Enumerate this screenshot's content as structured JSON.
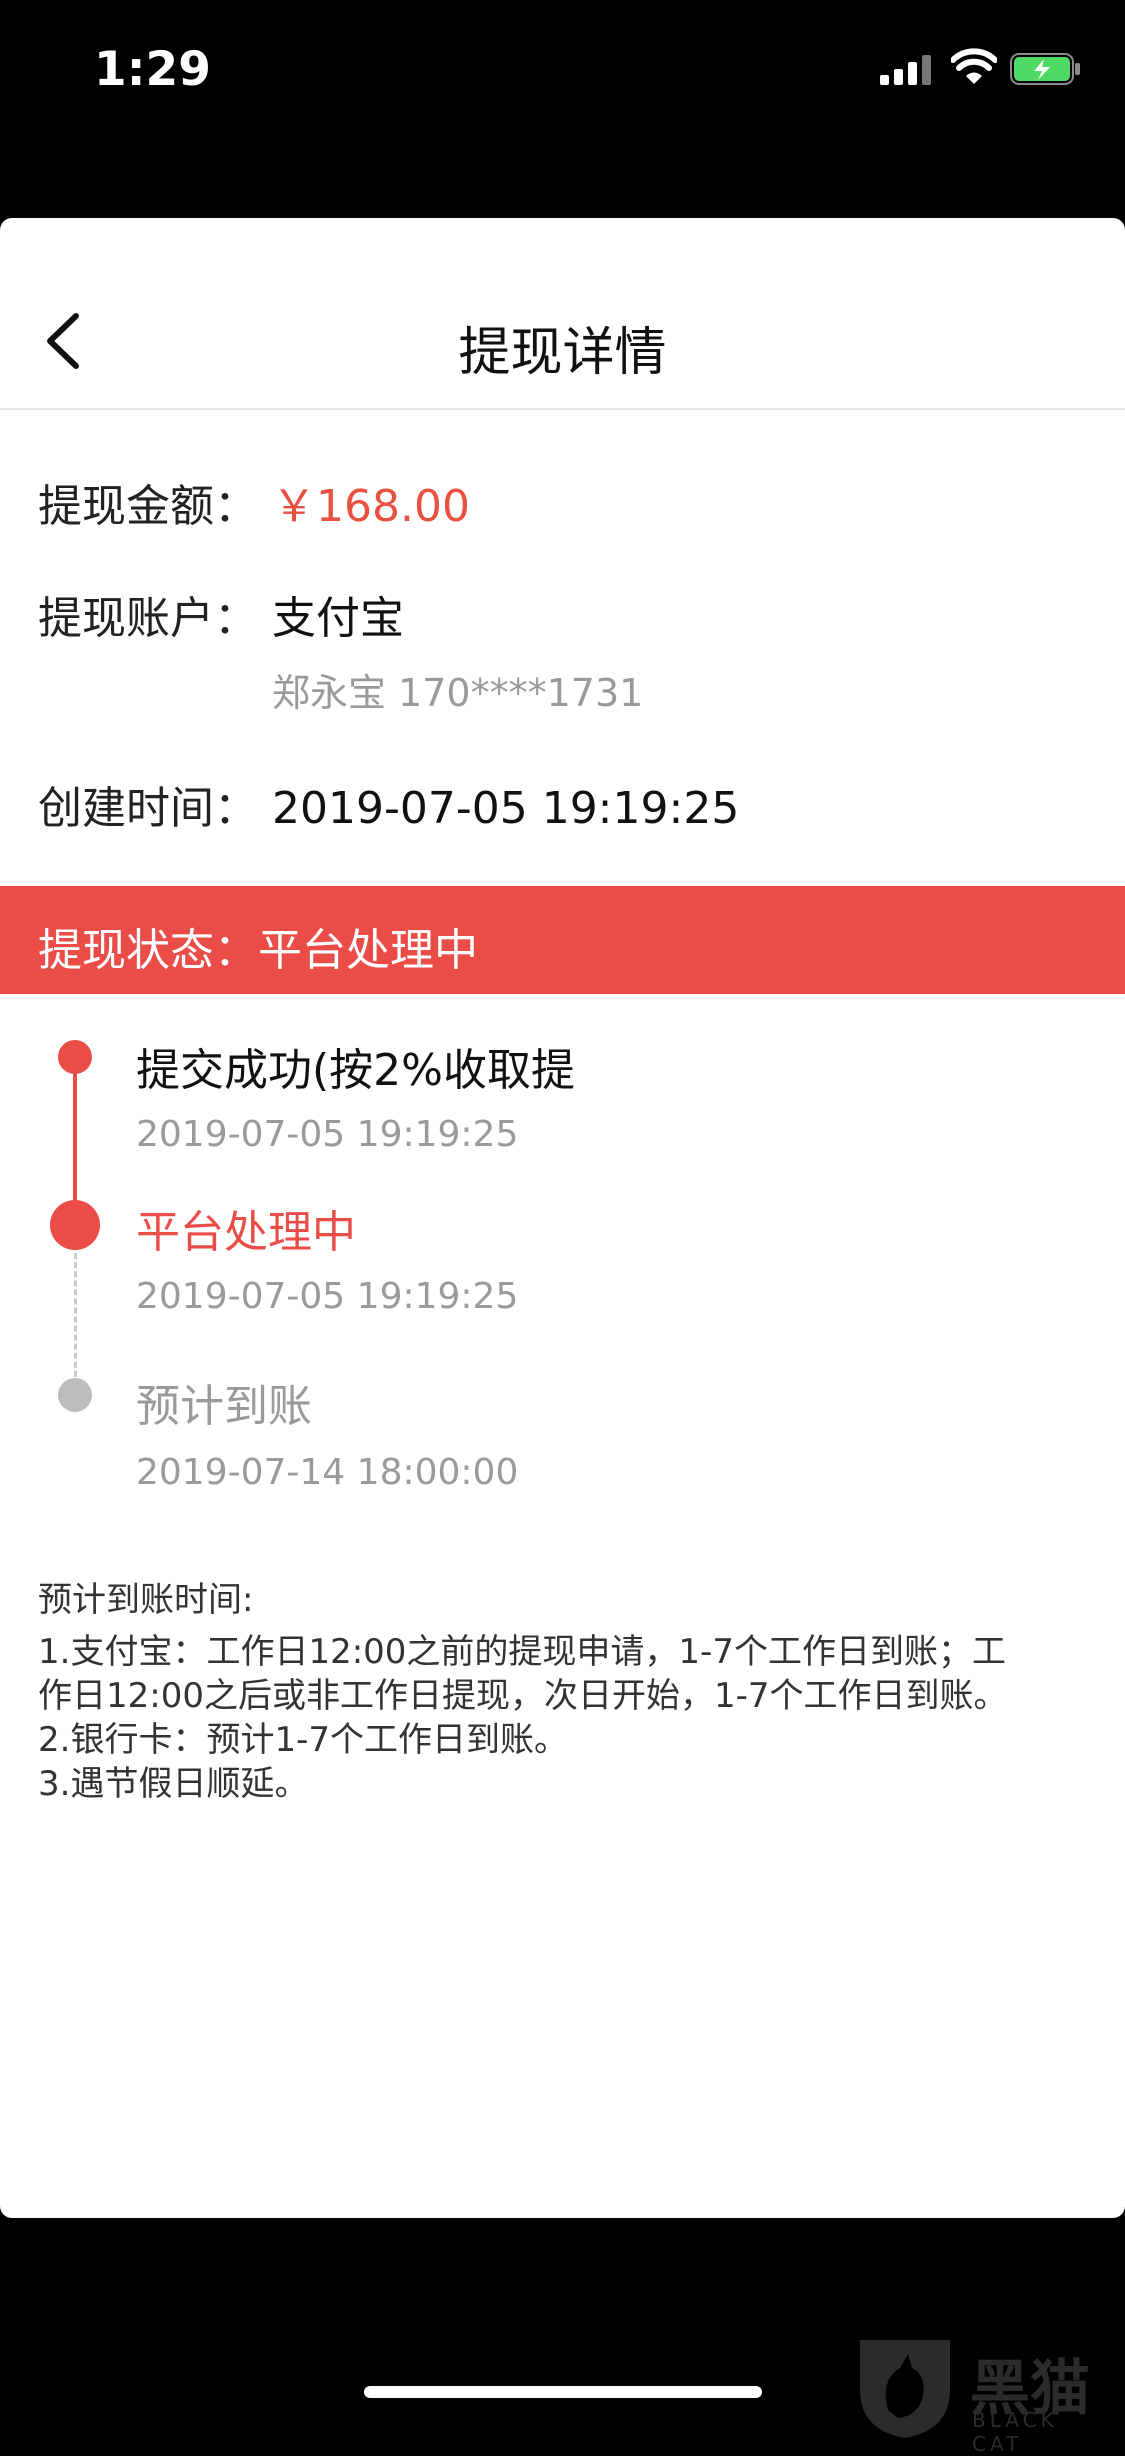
{
  "status_bar": {
    "time": "1:29"
  },
  "nav": {
    "title": "提现详情"
  },
  "details": {
    "amount_label": "提现金额：",
    "amount_value": "￥168.00",
    "account_label": "提现账户：",
    "account_value": "支付宝",
    "account_holder": "郑永宝 170****1731",
    "created_label": "创建时间：",
    "created_value": "2019-07-05 19:19:25"
  },
  "status": {
    "text": "提现状态：平台处理中"
  },
  "timeline": [
    {
      "title": "提交成功(按2%收取提",
      "time": "2019-07-05 19:19:25",
      "state": "done"
    },
    {
      "title": "平台处理中",
      "time": "2019-07-05 19:19:25",
      "state": "current"
    },
    {
      "title": "预计到账",
      "time": "2019-07-14 18:00:00",
      "state": "pending"
    }
  ],
  "notes": {
    "heading": "预计到账时间:",
    "lines": [
      "1.支付宝：工作日12:00之前的提现申请，1-7个工作日到账；工",
      "作日12:00之后或非工作日提现，次日开始，1-7个工作日到账。",
      "2.银行卡：预计1-7个工作日到账。",
      "3.遇节假日顺延。"
    ]
  },
  "watermark": {
    "cn": "黑猫",
    "en": "BLACK CAT"
  },
  "colors": {
    "accent": "#ea4d48",
    "amount": "#e8503f",
    "muted": "#9a9a9a",
    "pending_dot": "#bdbdbd"
  }
}
